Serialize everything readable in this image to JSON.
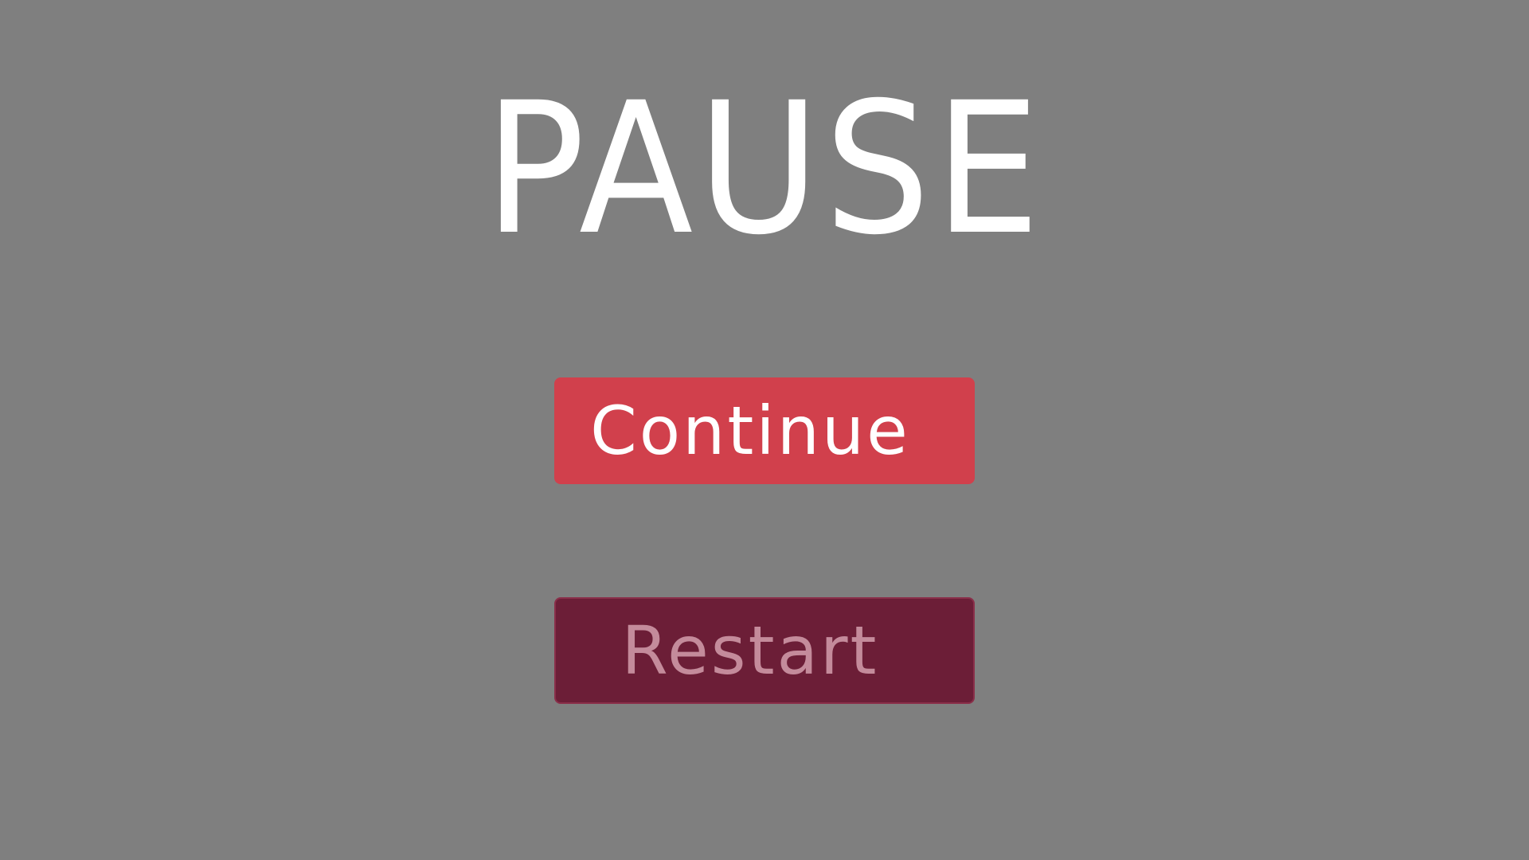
{
  "screen": {
    "title": "PAUSE"
  },
  "menu": {
    "continue_label": "Continue",
    "restart_label": "Restart"
  },
  "colors": {
    "background": "#7f7f7f",
    "title_text": "#ffffff",
    "continue_button": "#d1404c",
    "continue_text": "#ffffff",
    "restart_button": "#6c1e37",
    "restart_text": "#c48b9b"
  }
}
